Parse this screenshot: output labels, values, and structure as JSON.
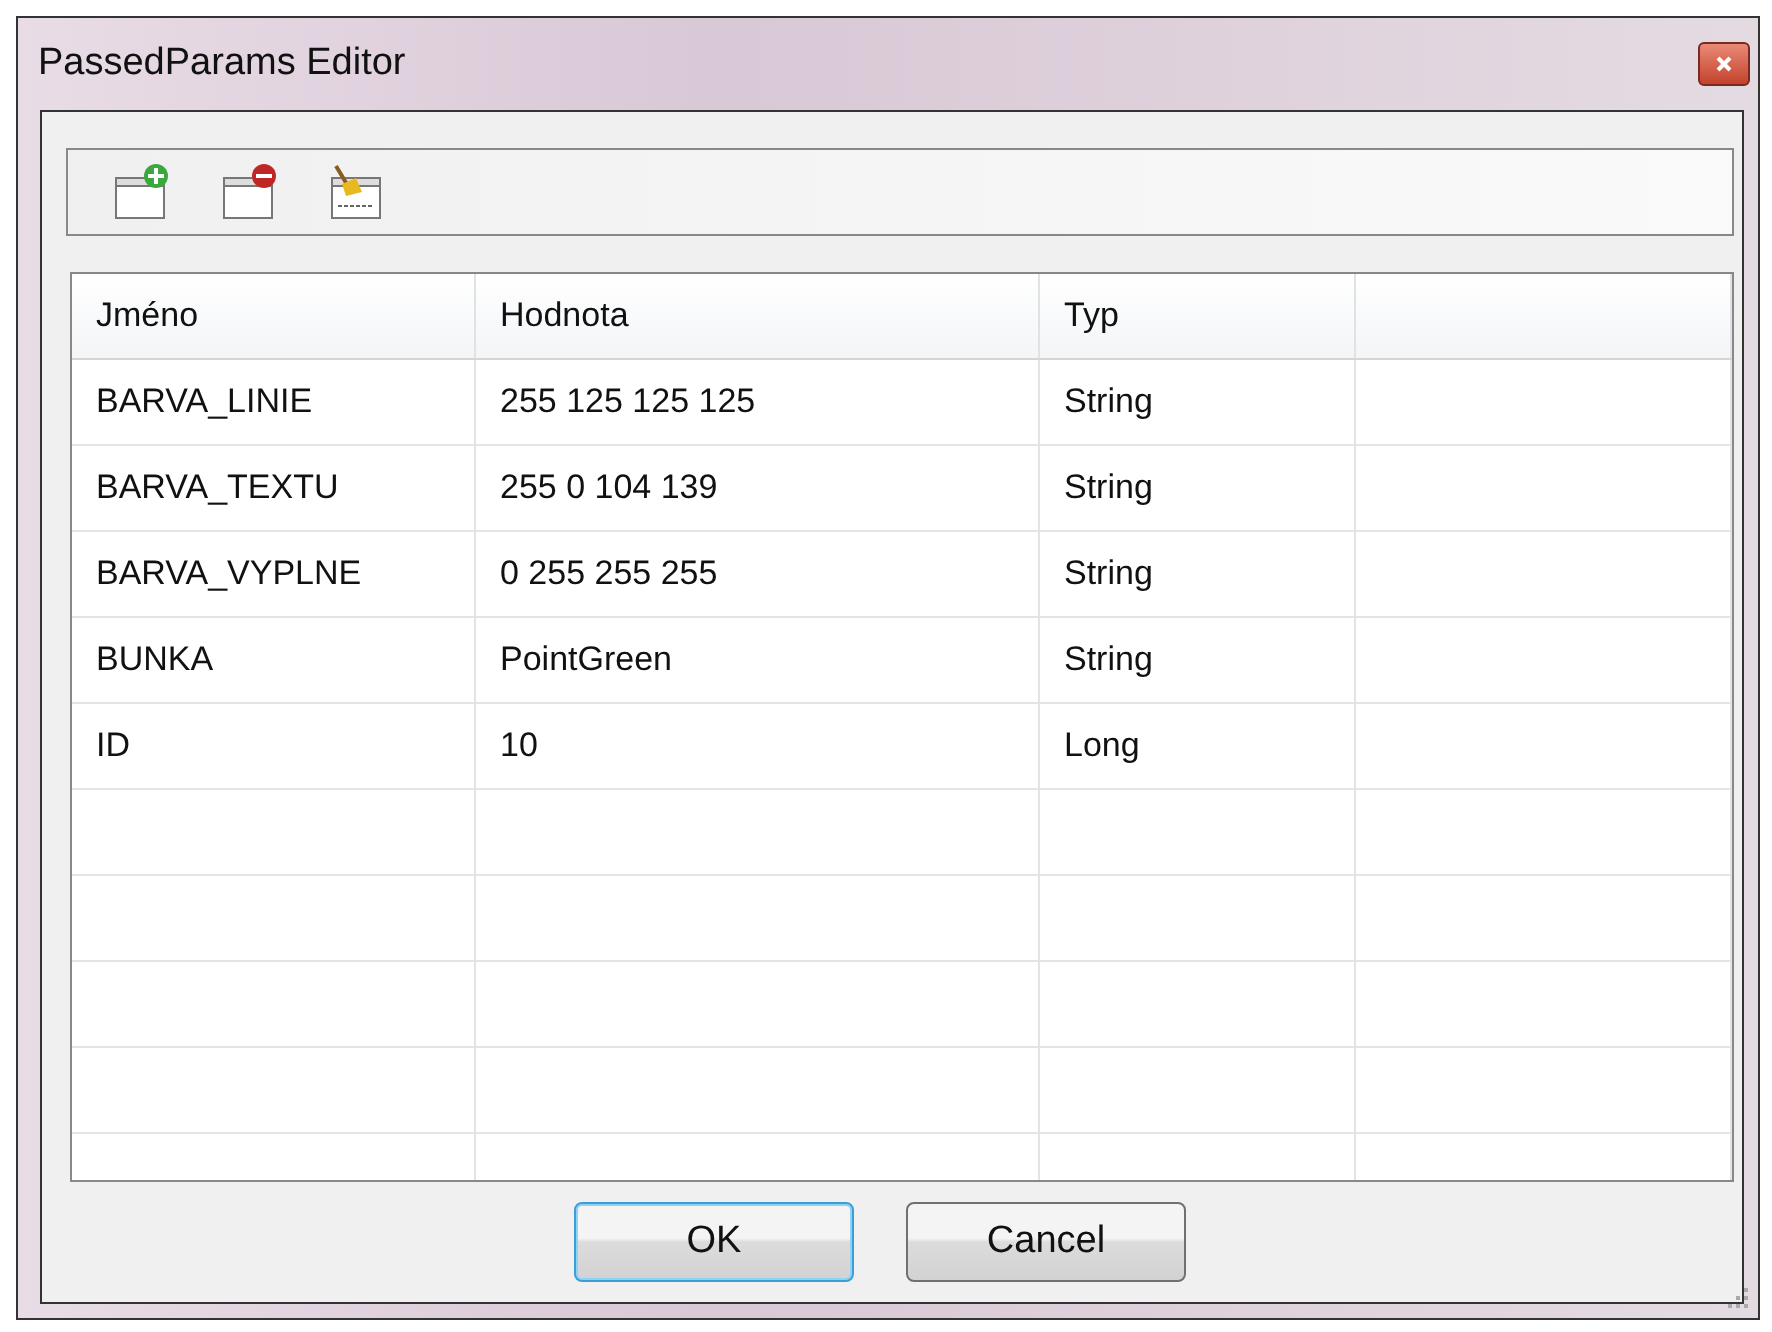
{
  "window": {
    "title": "PassedParams Editor"
  },
  "toolbar": {
    "buttons": [
      {
        "kind": "add"
      },
      {
        "kind": "remove"
      },
      {
        "kind": "null"
      }
    ]
  },
  "table": {
    "columns": [
      "Jméno",
      "Hodnota",
      "Typ"
    ],
    "rows": [
      [
        "BARVA_LINIE",
        "255 125 125 125",
        "String"
      ],
      [
        "BARVA_TEXTU",
        "255 0 104 139",
        "String"
      ],
      [
        "BARVA_VYPLNE",
        "0 255 255 255",
        "String"
      ],
      [
        "BUNKA",
        "PointGreen",
        "String"
      ],
      [
        "ID",
        "10",
        "Long"
      ]
    ]
  },
  "buttons": [
    {
      "label": "OK",
      "default": true
    },
    {
      "label": "Cancel",
      "default": false
    }
  ]
}
